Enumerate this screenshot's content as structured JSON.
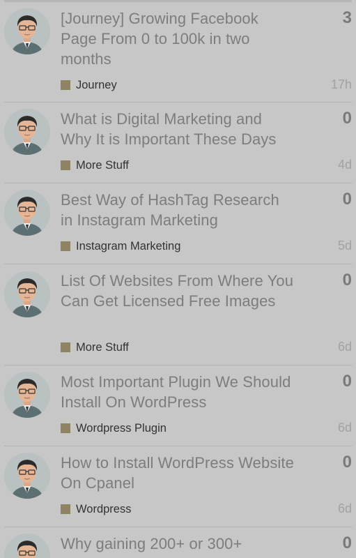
{
  "colors": {
    "background": "#c7c7c7",
    "category_swatch": "#8e8464",
    "title_text": "#7d7d7d",
    "divider": "#b3b3b3"
  },
  "topics": [
    {
      "avatar_icon": "user-avatar-icon",
      "title": "[Journey] Growing Facebook Page From 0 to 100k in two months",
      "replies": "3",
      "category": "Journey",
      "age": "17h"
    },
    {
      "avatar_icon": "user-avatar-icon",
      "title": "What is Digital Marketing and Why It is Important These Days",
      "replies": "0",
      "category": "More Stuff",
      "age": "4d"
    },
    {
      "avatar_icon": "user-avatar-icon",
      "title": "Best Way of HashTag Research in Instagram Marketing",
      "replies": "0",
      "category": "Instagram Marketing",
      "age": "5d"
    },
    {
      "avatar_icon": "user-avatar-icon",
      "title": "List Of Websites From Where You Can Get Licensed Free Images",
      "replies": "0",
      "category": "More Stuff",
      "age": "6d"
    },
    {
      "avatar_icon": "user-avatar-icon",
      "title": "Most Important Plugin We Should Install On WordPress",
      "replies": "0",
      "category": "Wordpress Plugin",
      "age": "6d"
    },
    {
      "avatar_icon": "user-avatar-icon",
      "title": "How to Install WordPress Website On Cpanel",
      "replies": "0",
      "category": "Wordpress",
      "age": "6d"
    },
    {
      "avatar_icon": "user-avatar-icon",
      "title": "Why gaining 200+ or 300+",
      "replies": "0",
      "category": "",
      "age": ""
    }
  ]
}
